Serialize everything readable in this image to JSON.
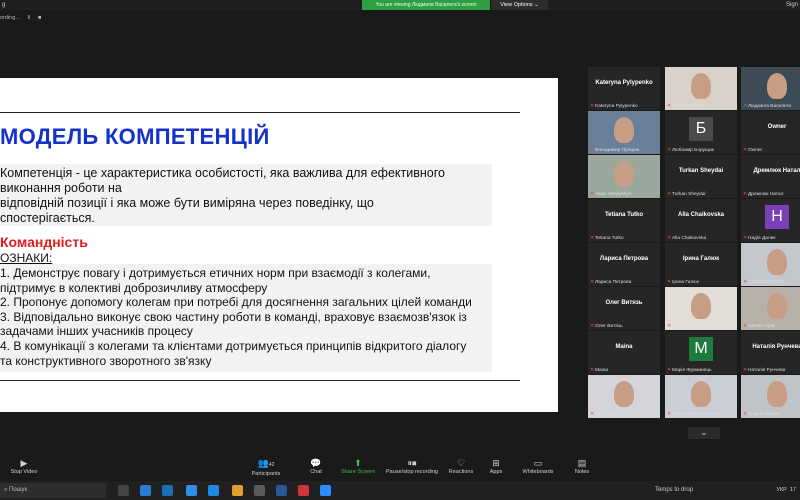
{
  "topbar": {
    "left": "g",
    "viewing_banner": "You are viewing Людмила Василега's screen",
    "view_options": "View Options",
    "right": "Sign"
  },
  "recording": {
    "label": "ording...",
    "pause": "II",
    "stop": "■"
  },
  "slide": {
    "title": "МОДЕЛЬ КОМПЕТЕНЦІЙ",
    "definition_lines": [
      "Компетенція - це характеристика особистості, яка важлива для ефективного",
      "виконання роботи на",
      "відповідній позиції і яка може бути виміряна через поведінку, що",
      "спостерігається."
    ],
    "section": "Командність",
    "signs_label": "ОЗНАКИ:",
    "items": [
      " 1. Демонструє повагу і дотримується етичних норм при взаємодії з колегами,",
      "підтримує в колективі доброзичливу атмосферу",
      "2. Пропонує допомогу колегам при потребі для досягнення загальних цілей команди",
      "3. Відповідально виконує свою частину роботи в команді, враховує взаємозв'язок із",
      "задачами інших учасників процесу",
      "4. В комунікації з колегами та клієнтами дотримується принципів відкритого діалогу",
      "та конструктивного зворотного зв'язку"
    ]
  },
  "participants": [
    {
      "display": "Kateryna  Pylypenko",
      "label": "Kateryna Pylypenko",
      "kind": "name"
    },
    {
      "display": "",
      "label": "ЕНТУНГ КЦПО",
      "kind": "video",
      "color": "#d9d2cb"
    },
    {
      "display": "",
      "label": "Людмила Василега",
      "kind": "video",
      "color": "#3d4b56",
      "active": true
    },
    {
      "display": "",
      "label": "Володимир Процюк",
      "kind": "video",
      "color": "#6a7f98"
    },
    {
      "display": "Б",
      "label": "Любомир Борущак",
      "kind": "avatar",
      "color": "#4a4a4a"
    },
    {
      "display": "Owner",
      "label": "Owner",
      "kind": "name"
    },
    {
      "display": "",
      "label": "Vitalii Vasylyshyn",
      "kind": "video",
      "color": "#9aa79c"
    },
    {
      "display": "Turkan Sheydai",
      "label": "Turkan Sheydai",
      "kind": "name"
    },
    {
      "display": "Дремлюк  Натал",
      "label": "Дремлюк Натал",
      "kind": "name"
    },
    {
      "display": "Tetiana Tutko",
      "label": "Tetiana Tutko",
      "kind": "name"
    },
    {
      "display": "Alla Chaikovska",
      "label": "Alla Chaikovska",
      "kind": "name"
    },
    {
      "display": "Н",
      "label": "Надія Далик",
      "kind": "avatar",
      "color": "#7b3fb8"
    },
    {
      "display": "Лариса Петрова",
      "label": "Лариса Петрова",
      "kind": "name"
    },
    {
      "display": "Ірина Галюк",
      "label": "Ірина Галюк",
      "kind": "name"
    },
    {
      "display": "",
      "label": "Galyna Kryvenko",
      "kind": "video",
      "color": "#c4c8cc"
    },
    {
      "display": "Олег Витязь",
      "label": "Олег Витязь",
      "kind": "name"
    },
    {
      "display": "",
      "label": "Лілія Хайдарова",
      "kind": "video",
      "color": "#e2ddd6"
    },
    {
      "display": "",
      "label": "Natalia Opar",
      "kind": "video",
      "color": "#b7b1aa"
    },
    {
      "display": "Maina",
      "label": "Maina",
      "kind": "name"
    },
    {
      "display": "М",
      "label": "Марія Фурманець",
      "kind": "avatar",
      "color": "#1f7a3d"
    },
    {
      "display": "Наталія  Рунчева",
      "label": "Наталія Рунчева",
      "kind": "name"
    },
    {
      "display": "",
      "label": "Ната Barbe",
      "kind": "video",
      "color": "#d3d5d8"
    },
    {
      "display": "",
      "label": "Олександр Пристемс",
      "kind": "video",
      "color": "#c9ced4"
    },
    {
      "display": "",
      "label": "Андрій Шатіль",
      "kind": "video",
      "color": "#bfc4c9"
    }
  ],
  "toolbar": {
    "stop_video": "Stop Video",
    "participants": "Participants",
    "participants_count": "42",
    "chat": "Chat",
    "share_screen": "Share Screen",
    "pause_recording": "Pause/stop recording",
    "reactions": "Reactions",
    "apps": "Apps",
    "whiteboards": "Whiteboards",
    "notes": "Notes"
  },
  "taskbar": {
    "search": "Пошук",
    "temps": "Temps to drop",
    "lang": "УКР",
    "time": "17"
  },
  "colors": {
    "title_blue": "#1532c8",
    "section_red": "#e01b1b",
    "banner_green": "#2ea043"
  }
}
